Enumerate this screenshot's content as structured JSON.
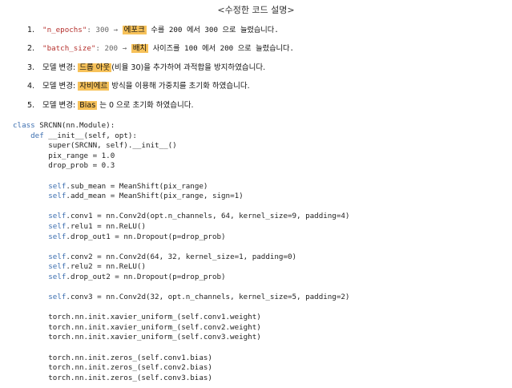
{
  "title": "<수정한 코드 설명>",
  "notes": [
    {
      "num": "1.",
      "key": "\"n_epochs\"",
      "before": ": 300 → ",
      "hl": "에포크",
      "after": " 수를 200 에서 300 으로 늘렸습니다."
    },
    {
      "num": "2.",
      "key": "\"batch_size\"",
      "before": ": 200 → ",
      "hl": "배치",
      "after": " 사이즈를 100 에서 200 으로 늘렸습니다."
    },
    {
      "num": "3.",
      "key": "",
      "before": "모델 변경: ",
      "hl": "드롭 아웃",
      "after": "(비율 30)을 추가하여 과적합을 방지하였습니다."
    },
    {
      "num": "4.",
      "key": "",
      "before": "모델 변경: ",
      "hl": "자비에르",
      "after": " 방식을 이용해 가중치를 초기화 하였습니다."
    },
    {
      "num": "5.",
      "key": "",
      "before": "모델 변경: ",
      "hl": "Bias",
      "after": " 는 0 으로 초기화 하였습니다."
    }
  ],
  "code": [
    {
      "indent": "",
      "kw": "class",
      "text": " SRCNN(nn.Module):"
    },
    {
      "indent": "    ",
      "kw": "def",
      "text": " __init__(self, opt):"
    },
    {
      "indent": "        ",
      "kw": "",
      "text": "super(SRCNN, self).__init__()"
    },
    {
      "indent": "        ",
      "kw": "",
      "text": "pix_range = 1.0"
    },
    {
      "indent": "        ",
      "kw": "",
      "text": "drop_prob = 0.3"
    },
    {
      "indent": "",
      "kw": "",
      "text": ""
    },
    {
      "indent": "        ",
      "kw": "self",
      "text": ".sub_mean = MeanShift(pix_range)"
    },
    {
      "indent": "        ",
      "kw": "self",
      "text": ".add_mean = MeanShift(pix_range, sign=1)"
    },
    {
      "indent": "",
      "kw": "",
      "text": ""
    },
    {
      "indent": "        ",
      "kw": "self",
      "text": ".conv1 = nn.Conv2d(opt.n_channels, 64, kernel_size=9, padding=4)"
    },
    {
      "indent": "        ",
      "kw": "self",
      "text": ".relu1 = nn.ReLU()"
    },
    {
      "indent": "        ",
      "kw": "self",
      "text": ".drop_out1 = nn.Dropout(p=drop_prob)"
    },
    {
      "indent": "",
      "kw": "",
      "text": ""
    },
    {
      "indent": "        ",
      "kw": "self",
      "text": ".conv2 = nn.Conv2d(64, 32, kernel_size=1, padding=0)"
    },
    {
      "indent": "        ",
      "kw": "self",
      "text": ".relu2 = nn.ReLU()"
    },
    {
      "indent": "        ",
      "kw": "self",
      "text": ".drop_out2 = nn.Dropout(p=drop_prob)"
    },
    {
      "indent": "",
      "kw": "",
      "text": ""
    },
    {
      "indent": "        ",
      "kw": "self",
      "text": ".conv3 = nn.Conv2d(32, opt.n_channels, kernel_size=5, padding=2)"
    },
    {
      "indent": "",
      "kw": "",
      "text": ""
    },
    {
      "indent": "        ",
      "kw": "",
      "text": "torch.nn.init.xavier_uniform_(self.conv1.weight)"
    },
    {
      "indent": "        ",
      "kw": "",
      "text": "torch.nn.init.xavier_uniform_(self.conv2.weight)"
    },
    {
      "indent": "        ",
      "kw": "",
      "text": "torch.nn.init.xavier_uniform_(self.conv3.weight)"
    },
    {
      "indent": "",
      "kw": "",
      "text": ""
    },
    {
      "indent": "        ",
      "kw": "",
      "text": "torch.nn.init.zeros_(self.conv1.bias)"
    },
    {
      "indent": "        ",
      "kw": "",
      "text": "torch.nn.init.zeros_(self.conv2.bias)"
    },
    {
      "indent": "        ",
      "kw": "",
      "text": "torch.nn.init.zeros_(self.conv3.bias)"
    }
  ]
}
